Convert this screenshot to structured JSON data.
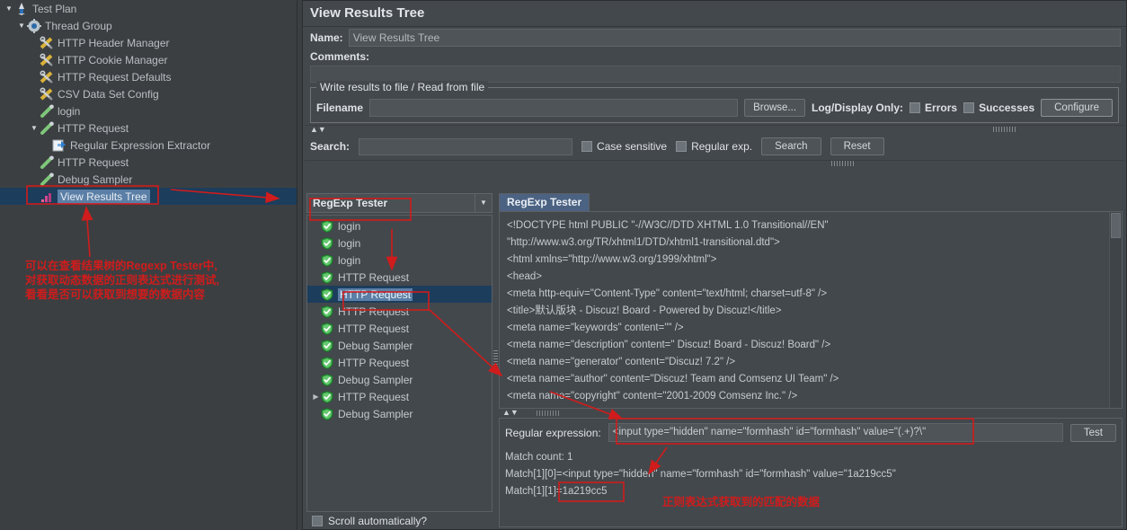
{
  "tree": {
    "items": [
      {
        "label": "Test Plan",
        "depth": 0,
        "twisty": "down",
        "icon": "test-plan-icon",
        "selected": false
      },
      {
        "label": "Thread Group",
        "depth": 1,
        "twisty": "down",
        "icon": "thread-group-icon",
        "selected": false
      },
      {
        "label": "HTTP Header Manager",
        "depth": 2,
        "twisty": "",
        "icon": "config-element-icon",
        "selected": false
      },
      {
        "label": "HTTP Cookie Manager",
        "depth": 2,
        "twisty": "",
        "icon": "config-element-icon",
        "selected": false
      },
      {
        "label": "HTTP Request Defaults",
        "depth": 2,
        "twisty": "",
        "icon": "config-element-icon",
        "selected": false
      },
      {
        "label": "CSV Data Set Config",
        "depth": 2,
        "twisty": "",
        "icon": "config-element-icon",
        "selected": false
      },
      {
        "label": "login",
        "depth": 2,
        "twisty": "",
        "icon": "sampler-icon",
        "selected": false
      },
      {
        "label": "HTTP Request",
        "depth": 2,
        "twisty": "down",
        "icon": "sampler-icon",
        "selected": false
      },
      {
        "label": "Regular Expression Extractor",
        "depth": 3,
        "twisty": "",
        "icon": "regex-extractor-icon",
        "selected": false
      },
      {
        "label": "HTTP Request",
        "depth": 2,
        "twisty": "",
        "icon": "sampler-icon",
        "selected": false
      },
      {
        "label": "Debug Sampler",
        "depth": 2,
        "twisty": "",
        "icon": "sampler-icon",
        "selected": false
      },
      {
        "label": "View Results Tree",
        "depth": 2,
        "twisty": "",
        "icon": "listener-icon",
        "selected": true
      }
    ]
  },
  "panel": {
    "title": "View Results Tree",
    "name_label": "Name:",
    "name_value": "View Results Tree",
    "comments_label": "Comments:",
    "comments_value": ""
  },
  "file_group": {
    "title": "Write results to file / Read from file",
    "filename_label": "Filename",
    "filename_value": "",
    "browse_label": "Browse...",
    "logdisplay_label": "Log/Display Only:",
    "errors_label": "Errors",
    "errors_checked": false,
    "successes_label": "Successes",
    "successes_checked": false,
    "configure_label": "Configure"
  },
  "search": {
    "label": "Search:",
    "value": "",
    "case_sensitive_label": "Case sensitive",
    "case_sensitive_checked": false,
    "regular_exp_label": "Regular exp.",
    "regular_exp_checked": false,
    "search_button": "Search",
    "reset_button": "Reset"
  },
  "results": {
    "view_selector_value": "RegExp Tester",
    "view_selector_arrow": "chevron-down",
    "scroll_auto_label": "Scroll automatically?",
    "scroll_auto_checked": false,
    "items": [
      {
        "label": "login",
        "status": "success",
        "twisty": "",
        "selected": false
      },
      {
        "label": "login",
        "status": "success",
        "twisty": "",
        "selected": false
      },
      {
        "label": "login",
        "status": "success",
        "twisty": "",
        "selected": false
      },
      {
        "label": "HTTP Request",
        "status": "success",
        "twisty": "",
        "selected": false
      },
      {
        "label": "HTTP Request",
        "status": "success",
        "twisty": "",
        "selected": true
      },
      {
        "label": "HTTP Request",
        "status": "success",
        "twisty": "",
        "selected": false
      },
      {
        "label": "HTTP Request",
        "status": "success",
        "twisty": "",
        "selected": false
      },
      {
        "label": "Debug Sampler",
        "status": "success",
        "twisty": "",
        "selected": false
      },
      {
        "label": "HTTP Request",
        "status": "success",
        "twisty": "",
        "selected": false
      },
      {
        "label": "Debug Sampler",
        "status": "success",
        "twisty": "",
        "selected": false
      },
      {
        "label": "HTTP Request",
        "status": "success",
        "twisty": "right",
        "selected": false
      },
      {
        "label": "Debug Sampler",
        "status": "success",
        "twisty": "",
        "selected": false
      }
    ]
  },
  "response_tab": {
    "label": "RegExp Tester",
    "source_lines": [
      "<!DOCTYPE html PUBLIC \"-//W3C//DTD XHTML 1.0 Transitional//EN\"",
      "\"http://www.w3.org/TR/xhtml1/DTD/xhtml1-transitional.dtd\">",
      "<html xmlns=\"http://www.w3.org/1999/xhtml\">",
      "<head>",
      "<meta http-equiv=\"Content-Type\" content=\"text/html; charset=utf-8\" />",
      "<title>默认版块  -  Discuz! Board  - Powered by Discuz!</title>",
      "<meta name=\"keywords\" content=\"\" />",
      "<meta name=\"description\" content=\" Discuz! Board  - Discuz! Board\" />",
      "<meta name=\"generator\" content=\"Discuz! 7.2\" />",
      "<meta name=\"author\" content=\"Discuz! Team and Comsenz UI Team\" />",
      "<meta name=\"copyright\" content=\"2001-2009 Comsenz Inc.\" />"
    ]
  },
  "regex_tester": {
    "label": "Regular expression:",
    "value": "<input type=\"hidden\" name=\"formhash\" id=\"formhash\" value=\"(.+)?\\\"",
    "test_button": "Test",
    "match_count_line": "Match count: 1",
    "match_lines": [
      "Match[1][0]=<input type=\"hidden\" name=\"formhash\" id=\"formhash\" value=\"1a219cc5\"",
      "Match[1][1]=1a219cc5"
    ],
    "highlight_value": "1a219cc5"
  },
  "annotations": {
    "accent_color": "#e02020",
    "left_note": "可以在查看结果树的Regexp Tester中,\n对获取动态数据的正则表达式进行测试,\n看看是否可以获取到想要的数据内容",
    "bottom_note": "正则表达式获取到的匹配的数据"
  }
}
